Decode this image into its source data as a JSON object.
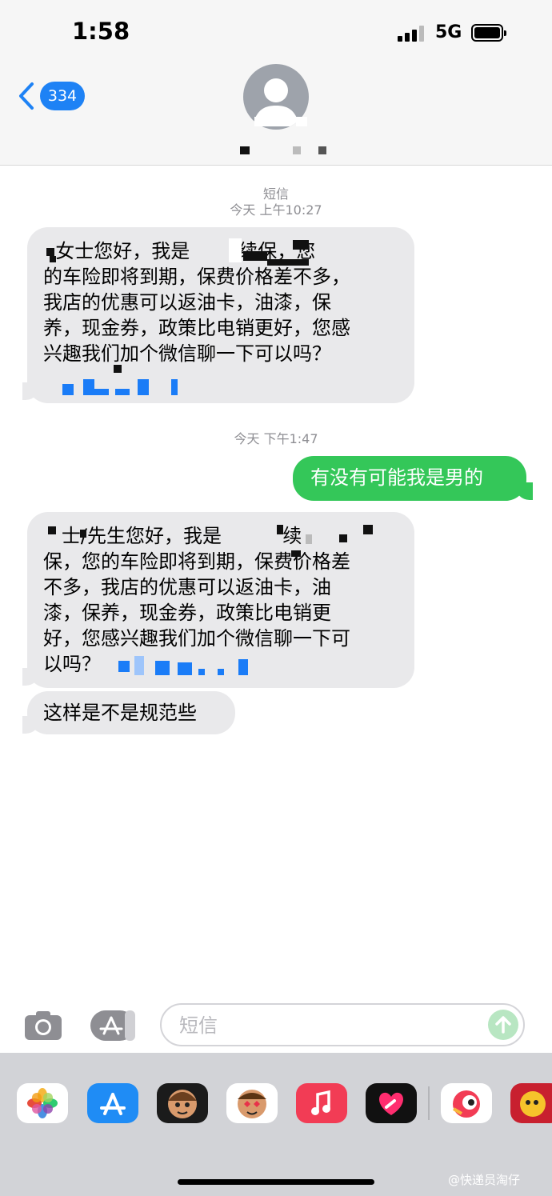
{
  "status_bar": {
    "time": "1:58",
    "network": "5G"
  },
  "nav": {
    "unread_count": "334"
  },
  "thread": {
    "service_label": "短信",
    "timestamp_1": "今天 上午10:27",
    "timestamp_2": "今天 下午1:47",
    "messages": [
      {
        "direction": "incoming",
        "text": "  女士您好，我是        续保，您\n的车险即将到期，保费价格差不多，\n我店的优惠可以返油卡，油漆，保\n养，现金券，政策比电销更好，您感\n兴趣我们加个微信聊一下可以吗？"
      },
      {
        "direction": "outgoing",
        "text": "有没有可能我是男的"
      },
      {
        "direction": "incoming",
        "text": "   士/先生您好，我是          续\n保，您的车险即将到期，保费价格差\n不多，我店的优惠可以返油卡，油\n漆，保养，现金券，政策比电销更\n好，您感兴趣我们加个微信聊一下可\n以吗？"
      },
      {
        "direction": "incoming",
        "text": "这样是不是规范些"
      }
    ]
  },
  "compose": {
    "placeholder": "短信"
  },
  "drawer": {
    "apps": [
      "photos-icon",
      "app-store-icon",
      "memoji-icon",
      "animoji-icon",
      "music-icon",
      "digital-touch-icon",
      "sticker-app-icon",
      "sticker-app-2-icon"
    ]
  },
  "watermark": "@快递员淘仔",
  "colors": {
    "accent_blue": "#1e82f5",
    "outgoing_green": "#34c759",
    "incoming_gray": "#e9e9eb"
  }
}
